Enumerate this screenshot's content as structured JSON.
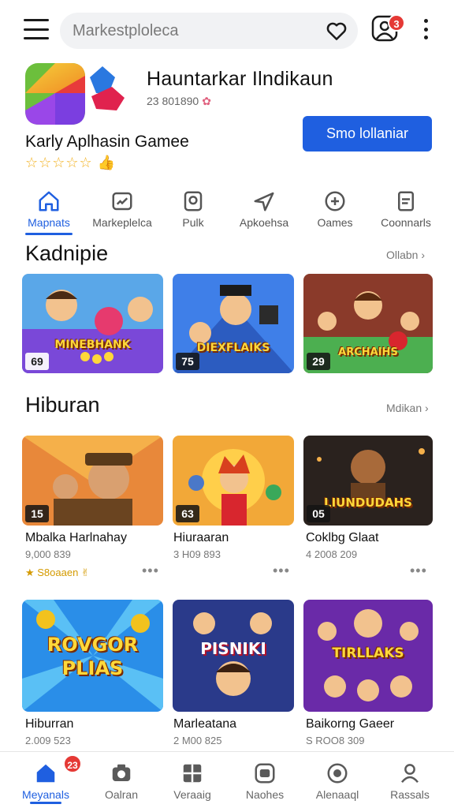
{
  "header": {
    "search_placeholder": "Markestploleca",
    "notification_count": "3"
  },
  "app": {
    "title": "Hauntarkar Ilndikaun",
    "meta": "23 801890",
    "name": "Karly Aplhasin Gamee",
    "rating_stars": "☆☆☆☆☆",
    "install_label": "Smo lollaniar",
    "accent_color": "#1f5fe0"
  },
  "categories": [
    {
      "label": "Mapnats",
      "icon": "home-icon",
      "active": true
    },
    {
      "label": "Markeplelca",
      "icon": "dashboard-icon",
      "active": false
    },
    {
      "label": "Pulk",
      "icon": "square-icon",
      "active": false
    },
    {
      "label": "Apkoehsa",
      "icon": "send-icon",
      "active": false
    },
    {
      "label": "Oames",
      "icon": "gamepad-icon",
      "active": false
    },
    {
      "label": "Coonnarls",
      "icon": "document-icon",
      "active": false
    }
  ],
  "sections": {
    "featured": {
      "title": "Kadnipie",
      "more": "Ollabn",
      "items": [
        {
          "badge": "69",
          "art": "MINEBHANK"
        },
        {
          "badge": "75",
          "art": "DIEXFLAIKS"
        },
        {
          "badge": "29",
          "art": "ARCHAIHS"
        }
      ]
    },
    "entertainment": {
      "title": "Hiburan",
      "more": "Mdikan",
      "items": [
        {
          "badge": "15",
          "title": "Mbalka Harlnahay",
          "sub": "9,000 839",
          "rating": "★ S8oaaen ✌"
        },
        {
          "badge": "63",
          "title": "Hiuraaran",
          "sub": "3 H09 893"
        },
        {
          "badge": "05",
          "title": "Coklbg Glaat",
          "sub": "4 2008 209"
        }
      ],
      "row2": [
        {
          "title": "Hiburran",
          "sub": "2.009 523",
          "art": "ROVGOR PLIAS"
        },
        {
          "title": "Marleatana",
          "sub": "2 M00 825",
          "art": "PISNIKI"
        },
        {
          "title": "Baikorng Gaeer",
          "sub": "S ROO8 309",
          "art": "TIRLLAKS"
        }
      ]
    }
  },
  "bottom_nav": [
    {
      "label": "Meyanals",
      "icon": "home-icon",
      "active": true
    },
    {
      "label": "Oalran",
      "icon": "camera-icon",
      "active": false
    },
    {
      "label": "Veraaig",
      "icon": "grid-icon",
      "active": false
    },
    {
      "label": "Naohes",
      "icon": "chat-icon",
      "active": false
    },
    {
      "label": "Alenaaql",
      "icon": "target-icon",
      "active": false
    },
    {
      "label": "Rassals",
      "icon": "person-icon",
      "active": false
    }
  ],
  "bottom_nav_badge": "23"
}
